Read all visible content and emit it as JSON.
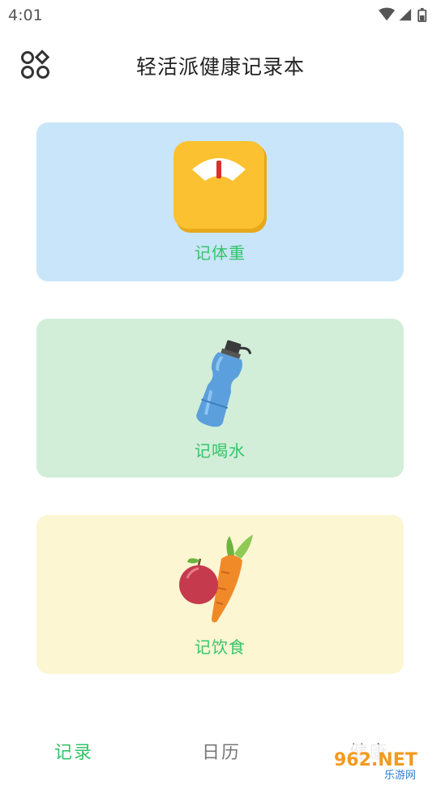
{
  "status_bar": {
    "time": "4:01",
    "icons": [
      "wifi-icon",
      "signal-icon",
      "battery-icon"
    ]
  },
  "app_bar": {
    "title": "轻活派健康记录本",
    "menu_icon": "grid-menu-icon"
  },
  "cards": [
    {
      "label": "记体重",
      "icon": "scale-icon",
      "background": "#c8e5f9"
    },
    {
      "label": "记喝水",
      "icon": "water-bottle-icon",
      "background": "#d2eed9"
    },
    {
      "label": "记饮食",
      "icon": "apple-carrot-icon",
      "background": "#fcf6d2"
    }
  ],
  "colors": {
    "accent": "#35c46a",
    "inactive_tab": "#777777"
  },
  "tabs": [
    {
      "label": "记录",
      "active": true
    },
    {
      "label": "日历",
      "active": false
    },
    {
      "label": "健康",
      "active": false
    }
  ],
  "watermark": {
    "text": "962.NET",
    "subtext": "乐游网"
  }
}
